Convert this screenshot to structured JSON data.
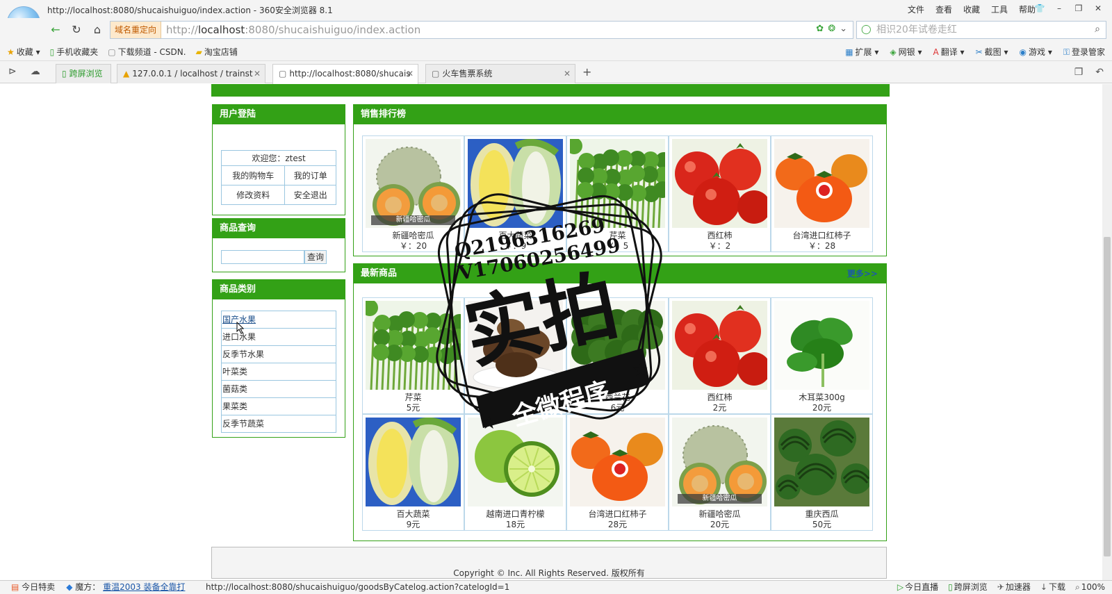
{
  "browser": {
    "window_title": "http://localhost:8080/shucaishuiguo/index.action - 360安全浏览器 8.1",
    "menu": [
      "文件",
      "查看",
      "收藏",
      "工具",
      "帮助"
    ],
    "redirect_badge": "域名重定向",
    "url_prefix": "http://",
    "url_host": "localhost",
    "url_rest": ":8080/shucaishuiguo/index.action",
    "search_placeholder": "相识20年试卷走红",
    "favorites": [
      "收藏",
      "手机收藏夹",
      "下载频道 - CSDN.",
      "淘宝店铺"
    ],
    "tools": [
      "扩展",
      "网银",
      "翻译",
      "截图",
      "游戏",
      "登录管家"
    ],
    "tabs": [
      {
        "label": "跨屏浏览",
        "active": false
      },
      {
        "label": "127.0.0.1 / localhost / trainst",
        "active": false
      },
      {
        "label": "http://localhost:8080/shucais",
        "active": true
      },
      {
        "label": "火车售票系统",
        "active": false
      }
    ]
  },
  "page": {
    "login": {
      "title": "用户登陆",
      "welcome": "欢迎您：ztest",
      "cart": "我的购物车",
      "orders": "我的订单",
      "profile": "修改资料",
      "logout": "安全退出"
    },
    "search": {
      "title": "商品查询",
      "button": "查询",
      "value": ""
    },
    "categories": {
      "title": "商品类别",
      "items": [
        "国产水果",
        "进口水果",
        "反季节水果",
        "叶菜类",
        "菌菇类",
        "果菜类",
        "反季节蔬菜"
      ]
    },
    "ranking": {
      "title": "销售排行榜",
      "items": [
        {
          "name": "新疆哈密瓜",
          "price": "￥：20",
          "img": "melon"
        },
        {
          "name": "百大蔬菜",
          "price": "￥：9",
          "img": "cabbage"
        },
        {
          "name": "芹菜",
          "price": "￥：5",
          "img": "celery"
        },
        {
          "name": "西红柿",
          "price": "￥：2",
          "img": "tomato"
        },
        {
          "name": "台湾进口红柿子",
          "price": "￥：28",
          "img": "persimmon"
        }
      ]
    },
    "newest": {
      "title": "最新商品",
      "more": "更多>>",
      "items": [
        {
          "name": "芹菜",
          "price": "5元",
          "img": "celery"
        },
        {
          "name": "香菇",
          "price": "80元",
          "img": "mushroom"
        },
        {
          "name": "西兰花",
          "price": "6元",
          "img": "broccoli"
        },
        {
          "name": "西红柿",
          "price": "2元",
          "img": "tomato"
        },
        {
          "name": "木耳菜300g",
          "price": "20元",
          "img": "spinach"
        },
        {
          "name": "百大蔬菜",
          "price": "9元",
          "img": "cabbage"
        },
        {
          "name": "越南进口青柠檬",
          "price": "18元",
          "img": "lime"
        },
        {
          "name": "台湾进口红柿子",
          "price": "28元",
          "img": "persimmon"
        },
        {
          "name": "新疆哈密瓜",
          "price": "20元",
          "img": "melon"
        },
        {
          "name": "重庆西瓜",
          "price": "50元",
          "img": "watermelon"
        }
      ]
    },
    "melon_tag": "新疆哈密瓜",
    "footer": "Copyright © Inc. All Rights Reserved. 版权所有"
  },
  "watermark": {
    "line1": "Q2196316269",
    "line2": "V17060256499",
    "big": "实拍",
    "ribbon": "全微程序"
  },
  "statusbar": {
    "left": [
      "今日特卖",
      "魔方："
    ],
    "link": "重温2003 装备全靠打",
    "url": "http://localhost:8080/shucaishuiguo/goodsByCatelog.action?catelogId=1",
    "right": [
      "今日直播",
      "跨屏浏览",
      "加速器",
      "下载",
      "100%"
    ]
  },
  "colors": {
    "brand_green": "#33a116",
    "table_border": "#9ac6e0",
    "more_link": "#1b5aa8"
  }
}
